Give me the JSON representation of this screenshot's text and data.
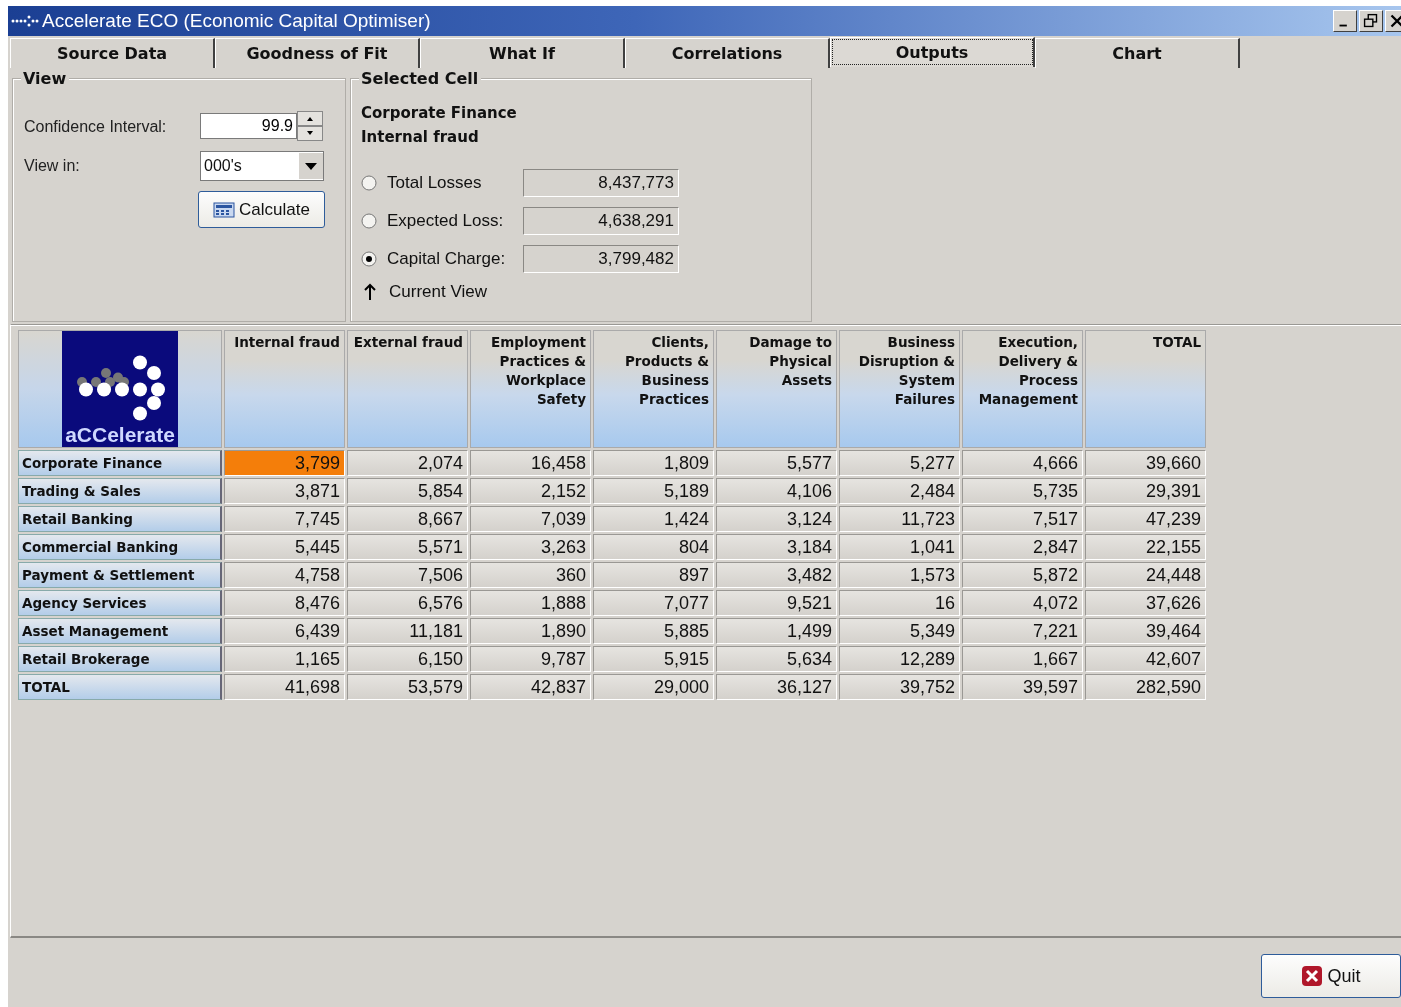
{
  "window": {
    "title": "Accelerate ECO (Economic Capital Optimiser)"
  },
  "tabs": [
    {
      "label": "Source Data",
      "selected": false
    },
    {
      "label": "Goodness of Fit",
      "selected": false
    },
    {
      "label": "What If",
      "selected": false
    },
    {
      "label": "Correlations",
      "selected": false
    },
    {
      "label": "Outputs",
      "selected": true
    },
    {
      "label": "Chart",
      "selected": false
    }
  ],
  "view_panel": {
    "title": "View",
    "confidence_interval": {
      "label": "Confidence Interval:",
      "value": "99.9"
    },
    "view_in": {
      "label": "View in:",
      "value": "000's"
    },
    "calculate_button": "Calculate"
  },
  "selected_cell_panel": {
    "title": "Selected Cell",
    "row_name": "Corporate Finance",
    "column_name": "Internal fraud",
    "options": [
      {
        "label": "Total Losses",
        "value": "8,437,773",
        "selected": false
      },
      {
        "label": "Expected Loss:",
        "value": "4,638,291",
        "selected": false
      },
      {
        "label": "Capital Charge:",
        "value": "3,799,482",
        "selected": true
      }
    ],
    "current_view": "Current View"
  },
  "table": {
    "logo_text": "a**CC**elerate",
    "columns": [
      "Internal fraud",
      "External fraud",
      "Employment Practices & Workplace Safety",
      "Clients, Products & Business Practices",
      "Damage to Physical Assets",
      "Business Disruption & System Failures",
      "Execution, Delivery & Process Management",
      "TOTAL"
    ],
    "rows": [
      {
        "label": "Corporate Finance",
        "cells": [
          {
            "text": "3,799",
            "selected": true
          },
          {
            "text": "2,074",
            "selected": false
          },
          {
            "text": "16,458",
            "selected": false
          },
          {
            "text": "1,809",
            "selected": false
          },
          {
            "text": "5,577",
            "selected": false
          },
          {
            "text": "5,277",
            "selected": false
          },
          {
            "text": "4,666",
            "selected": false
          },
          {
            "text": "39,660",
            "selected": false
          }
        ]
      },
      {
        "label": "Trading & Sales",
        "cells": [
          {
            "text": "3,871",
            "selected": false
          },
          {
            "text": "5,854",
            "selected": false
          },
          {
            "text": "2,152",
            "selected": false
          },
          {
            "text": "5,189",
            "selected": false
          },
          {
            "text": "4,106",
            "selected": false
          },
          {
            "text": "2,484",
            "selected": false
          },
          {
            "text": "5,735",
            "selected": false
          },
          {
            "text": "29,391",
            "selected": false
          }
        ]
      },
      {
        "label": "Retail Banking",
        "cells": [
          {
            "text": "7,745",
            "selected": false
          },
          {
            "text": "8,667",
            "selected": false
          },
          {
            "text": "7,039",
            "selected": false
          },
          {
            "text": "1,424",
            "selected": false
          },
          {
            "text": "3,124",
            "selected": false
          },
          {
            "text": "11,723",
            "selected": false
          },
          {
            "text": "7,517",
            "selected": false
          },
          {
            "text": "47,239",
            "selected": false
          }
        ]
      },
      {
        "label": "Commercial Banking",
        "cells": [
          {
            "text": "5,445",
            "selected": false
          },
          {
            "text": "5,571",
            "selected": false
          },
          {
            "text": "3,263",
            "selected": false
          },
          {
            "text": "804",
            "selected": false
          },
          {
            "text": "3,184",
            "selected": false
          },
          {
            "text": "1,041",
            "selected": false
          },
          {
            "text": "2,847",
            "selected": false
          },
          {
            "text": "22,155",
            "selected": false
          }
        ]
      },
      {
        "label": "Payment & Settlement",
        "cells": [
          {
            "text": "4,758",
            "selected": false
          },
          {
            "text": "7,506",
            "selected": false
          },
          {
            "text": "360",
            "selected": false
          },
          {
            "text": "897",
            "selected": false
          },
          {
            "text": "3,482",
            "selected": false
          },
          {
            "text": "1,573",
            "selected": false
          },
          {
            "text": "5,872",
            "selected": false
          },
          {
            "text": "24,448",
            "selected": false
          }
        ]
      },
      {
        "label": "Agency Services",
        "cells": [
          {
            "text": "8,476",
            "selected": false
          },
          {
            "text": "6,576",
            "selected": false
          },
          {
            "text": "1,888",
            "selected": false
          },
          {
            "text": "7,077",
            "selected": false
          },
          {
            "text": "9,521",
            "selected": false
          },
          {
            "text": "16",
            "selected": false
          },
          {
            "text": "4,072",
            "selected": false
          },
          {
            "text": "37,626",
            "selected": false
          }
        ]
      },
      {
        "label": "Asset Management",
        "cells": [
          {
            "text": "6,439",
            "selected": false
          },
          {
            "text": "11,181",
            "selected": false
          },
          {
            "text": "1,890",
            "selected": false
          },
          {
            "text": "5,885",
            "selected": false
          },
          {
            "text": "1,499",
            "selected": false
          },
          {
            "text": "5,349",
            "selected": false
          },
          {
            "text": "7,221",
            "selected": false
          },
          {
            "text": "39,464",
            "selected": false
          }
        ]
      },
      {
        "label": "Retail Brokerage",
        "cells": [
          {
            "text": "1,165",
            "selected": false
          },
          {
            "text": "6,150",
            "selected": false
          },
          {
            "text": "9,787",
            "selected": false
          },
          {
            "text": "5,915",
            "selected": false
          },
          {
            "text": "5,634",
            "selected": false
          },
          {
            "text": "12,289",
            "selected": false
          },
          {
            "text": "1,667",
            "selected": false
          },
          {
            "text": "42,607",
            "selected": false
          }
        ]
      },
      {
        "label": "TOTAL",
        "cells": [
          {
            "text": "41,698",
            "selected": false
          },
          {
            "text": "53,579",
            "selected": false
          },
          {
            "text": "42,837",
            "selected": false
          },
          {
            "text": "29,000",
            "selected": false
          },
          {
            "text": "36,127",
            "selected": false
          },
          {
            "text": "39,752",
            "selected": false
          },
          {
            "text": "39,597",
            "selected": false
          },
          {
            "text": "282,590",
            "selected": false
          }
        ]
      }
    ]
  },
  "quit_button": "Quit"
}
